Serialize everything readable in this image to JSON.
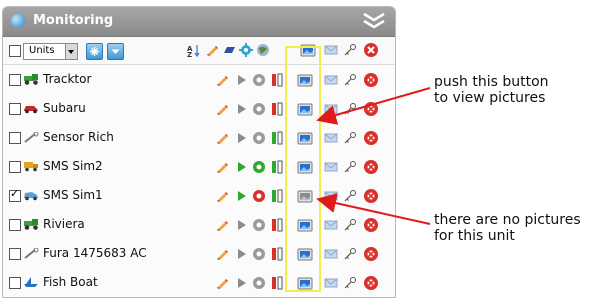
{
  "panel": {
    "title": "Monitoring",
    "units_select": "Units"
  },
  "units": [
    {
      "name": "Tracktor",
      "checked": false,
      "vehicle_icon": "tractor-icon",
      "has_pictures": true
    },
    {
      "name": "Subaru",
      "checked": false,
      "vehicle_icon": "car-icon",
      "has_pictures": true
    },
    {
      "name": "Sensor Rich",
      "checked": false,
      "vehicle_icon": "wrench-icon",
      "has_pictures": true
    },
    {
      "name": "SMS Sim2",
      "checked": false,
      "vehicle_icon": "truck-icon",
      "has_pictures": true
    },
    {
      "name": "SMS Sim1",
      "checked": true,
      "vehicle_icon": "van-icon",
      "has_pictures": false
    },
    {
      "name": "Riviera",
      "checked": false,
      "vehicle_icon": "tractor-icon",
      "has_pictures": true
    },
    {
      "name": "Fura 1475683 AC",
      "checked": false,
      "vehicle_icon": "wrench-icon",
      "has_pictures": true
    },
    {
      "name": "Fish Boat",
      "checked": false,
      "vehicle_icon": "boat-icon",
      "has_pictures": true
    }
  ],
  "annotations": {
    "push_button": "push this button\nto view pictures",
    "no_pictures": "there are no pictures\nfor this unit"
  },
  "colors": {
    "highlight": "#f4ee4a",
    "arrow": "#e01b1b",
    "picture_active": "#2a6fd0",
    "picture_inactive": "#8c8c8c"
  }
}
